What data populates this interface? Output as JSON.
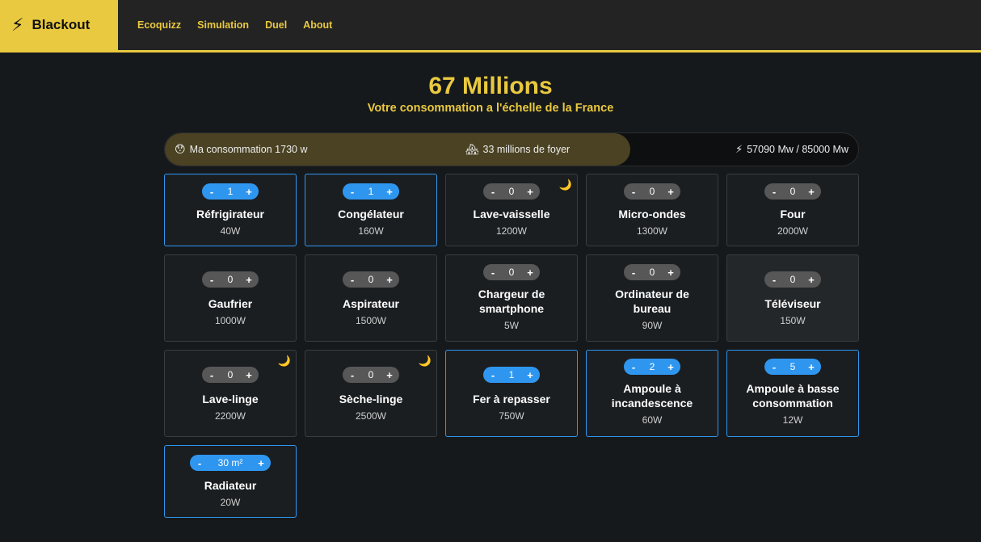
{
  "navbar": {
    "brand_icon": "bolt-icon",
    "brand": "Blackout",
    "links": [
      "Ecoquizz",
      "Simulation",
      "Duel",
      "About"
    ]
  },
  "hero": {
    "title": "67 Millions",
    "subtitle": "Votre consommation a l'échelle de la France"
  },
  "consumption": {
    "fill_fraction": 0.671,
    "mine": {
      "icon": "face-icon",
      "label": "Ma consommation 1730 w"
    },
    "homes": {
      "icon": "houses-icon",
      "label": "33 millions de foyer"
    },
    "grid": {
      "icon": "lightning-icon",
      "label": "57090 Mw / 85000 Mw"
    }
  },
  "appliances": [
    {
      "name": "Réfrigirateur",
      "watt": "40W",
      "count": "1",
      "active": true,
      "night": false,
      "muted": false
    },
    {
      "name": "Congélateur",
      "watt": "160W",
      "count": "1",
      "active": true,
      "night": false,
      "muted": false
    },
    {
      "name": "Lave-vaisselle",
      "watt": "1200W",
      "count": "0",
      "active": false,
      "night": true,
      "muted": false
    },
    {
      "name": "Micro-ondes",
      "watt": "1300W",
      "count": "0",
      "active": false,
      "night": false,
      "muted": false
    },
    {
      "name": "Four",
      "watt": "2000W",
      "count": "0",
      "active": false,
      "night": false,
      "muted": false
    },
    {
      "name": "Gaufrier",
      "watt": "1000W",
      "count": "0",
      "active": false,
      "night": false,
      "muted": false
    },
    {
      "name": "Aspirateur",
      "watt": "1500W",
      "count": "0",
      "active": false,
      "night": false,
      "muted": false
    },
    {
      "name": "Chargeur de smartphone",
      "watt": "5W",
      "count": "0",
      "active": false,
      "night": false,
      "muted": false
    },
    {
      "name": "Ordinateur de bureau",
      "watt": "90W",
      "count": "0",
      "active": false,
      "night": false,
      "muted": false
    },
    {
      "name": "Téléviseur",
      "watt": "150W",
      "count": "0",
      "active": false,
      "night": false,
      "muted": true
    },
    {
      "name": "Lave-linge",
      "watt": "2200W",
      "count": "0",
      "active": false,
      "night": true,
      "muted": false
    },
    {
      "name": "Sèche-linge",
      "watt": "2500W",
      "count": "0",
      "active": false,
      "night": true,
      "muted": false
    },
    {
      "name": "Fer à repasser",
      "watt": "750W",
      "count": "1",
      "active": true,
      "night": false,
      "muted": false
    },
    {
      "name": "Ampoule à incandescence",
      "watt": "60W",
      "count": "2",
      "active": true,
      "night": false,
      "muted": false
    },
    {
      "name": "Ampoule à basse consommation",
      "watt": "12W",
      "count": "5",
      "active": true,
      "night": false,
      "muted": false
    },
    {
      "name": "Radiateur",
      "watt": "20W",
      "count": "30 m²",
      "active": true,
      "night": false,
      "muted": false
    }
  ],
  "stepper": {
    "minus": "-",
    "plus": "+"
  },
  "night_icon": "moon-icon",
  "colors": {
    "accent": "#e9c93f",
    "active": "#2f96f0",
    "background": "#16191c"
  }
}
